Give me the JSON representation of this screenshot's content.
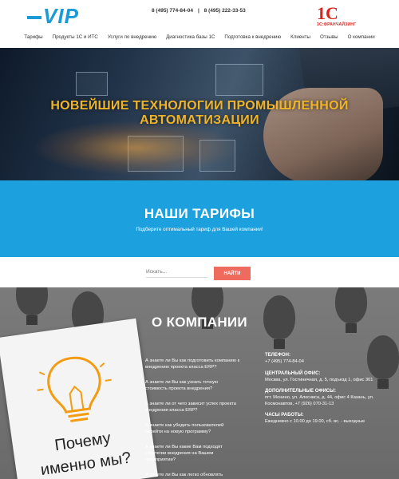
{
  "header": {
    "logo": "VIP",
    "phones": [
      "8 (495) 774-84-04",
      "8 (495) 222-33-53"
    ],
    "brand": {
      "mark": "1С",
      "sub": "1С:ФРАНЧАЙЗИНГ"
    }
  },
  "nav": [
    "Тарифы",
    "Продукты 1С и ИТС",
    "Услуги по внедрению",
    "Диагностика базы 1С",
    "Подготовка к внедрению",
    "Клиенты",
    "Отзывы",
    "О компании"
  ],
  "hero": {
    "title": "НОВЕЙШИЕ ТЕХНОЛОГИИ ПРОМЫШЛЕННОЙ АВТОМАТИЗАЦИИ"
  },
  "tariffs": {
    "title": "НАШИ ТАРИФЫ",
    "subtitle": "Подберите оптимальный тариф для Вашей компании!"
  },
  "search": {
    "placeholder": "Искать...",
    "button": "НАЙТИ"
  },
  "about": {
    "title": "О КОМПАНИИ",
    "card": {
      "line1": "Почему",
      "line2": "именно мы?"
    },
    "faq": [
      "А знаете ли Вы как подготовить компанию к внедрению проекта класса ERP?",
      "А знаете ли Вы как узнать точную стоимость проекта внедрения?",
      "А знаете ли от чего зависит успех проекта внедрения класса ERP?",
      "А знаете как убедить пользователей перейти на новую программу?",
      "А знаете ли Вы какие Вам подходят стратегии внедрения на Вашем предприятии?",
      "А знаете ли Вы как легко обновлять"
    ],
    "contacts": [
      {
        "title": "ТЕЛЕФОН:",
        "value": "+7 (495) 774-84-04"
      },
      {
        "title": "ЦЕНТРАЛЬНЫЙ ОФИС:",
        "value": "Москва, ул. Гостиничная, д. 5, подъезд 1, офис 301"
      },
      {
        "title": "ДОПОЛНИТЕЛЬНЫЕ ОФИСЫ:",
        "value": "пгт. Монино, ул. Алксниса, д. 44, офис 4 Казань, ул. Космонавтов, +7 (926) 070-31-13"
      },
      {
        "title": "ЧАСЫ РАБОТЫ:",
        "value": "Ежедневно с 10.00 до 19.00, сб. вс. - выходные"
      }
    ]
  }
}
